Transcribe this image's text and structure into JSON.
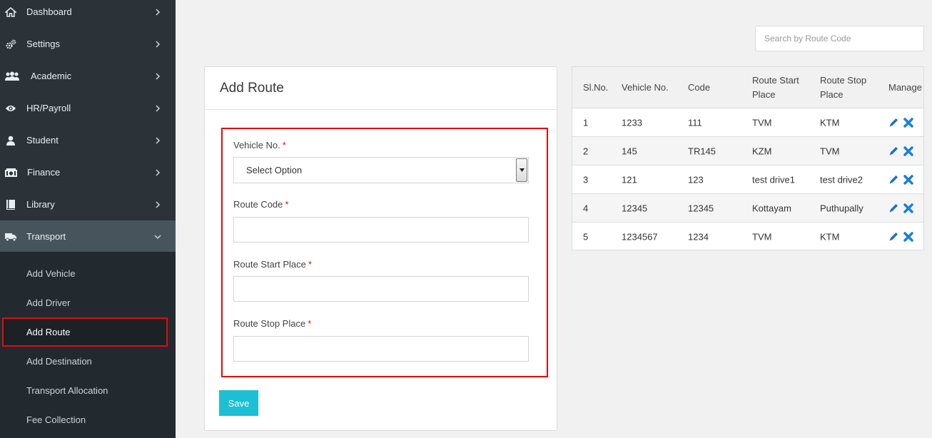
{
  "sidebar": {
    "items": [
      {
        "label": "Dashboard",
        "icon": "home-icon"
      },
      {
        "label": "Settings",
        "icon": "gears-icon"
      },
      {
        "label": "Academic",
        "icon": "users-icon"
      },
      {
        "label": "HR/Payroll",
        "icon": "eye-icon"
      },
      {
        "label": "Student",
        "icon": "user-icon"
      },
      {
        "label": "Finance",
        "icon": "money-icon"
      },
      {
        "label": "Library",
        "icon": "book-icon"
      },
      {
        "label": "Transport",
        "icon": "truck-icon"
      }
    ],
    "submenu": [
      {
        "label": "Add Vehicle"
      },
      {
        "label": "Add Driver"
      },
      {
        "label": "Add Route"
      },
      {
        "label": "Add Destination"
      },
      {
        "label": "Transport Allocation"
      },
      {
        "label": "Fee Collection"
      }
    ]
  },
  "search": {
    "placeholder": "Search by Route Code"
  },
  "form": {
    "title": "Add Route",
    "vehicle_label": "Vehicle No.",
    "vehicle_value": "Select Option",
    "route_code_label": "Route Code",
    "route_code_value": "",
    "start_label": "Route Start Place",
    "start_value": "",
    "stop_label": "Route Stop Place",
    "stop_value": "",
    "required_mark": "*",
    "save_label": "Save"
  },
  "table": {
    "headers": {
      "slno": "Sl.No.",
      "vehicle": "Vehicle No.",
      "code": "Code",
      "start": "Route Start Place",
      "stop": "Route Stop Place",
      "manage": "Manage"
    },
    "rows": [
      {
        "slno": "1",
        "vehicle": "1233",
        "code": "111",
        "start": "TVM",
        "stop": "KTM"
      },
      {
        "slno": "2",
        "vehicle": "145",
        "code": "TR145",
        "start": "KZM",
        "stop": "TVM"
      },
      {
        "slno": "3",
        "vehicle": "121",
        "code": "123",
        "start": "test drive1",
        "stop": "test drive2"
      },
      {
        "slno": "4",
        "vehicle": "12345",
        "code": "12345",
        "start": "Kottayam",
        "stop": "Puthupally"
      },
      {
        "slno": "5",
        "vehicle": "1234567",
        "code": "1234",
        "start": "TVM",
        "stop": "KTM"
      }
    ]
  },
  "colors": {
    "sidebar_bg": "#2b3338",
    "highlight": "#e00d0d",
    "save_button": "#1cbfd3",
    "edit_icon": "#1f6fc2",
    "delete_icon": "#1a7fd8"
  }
}
